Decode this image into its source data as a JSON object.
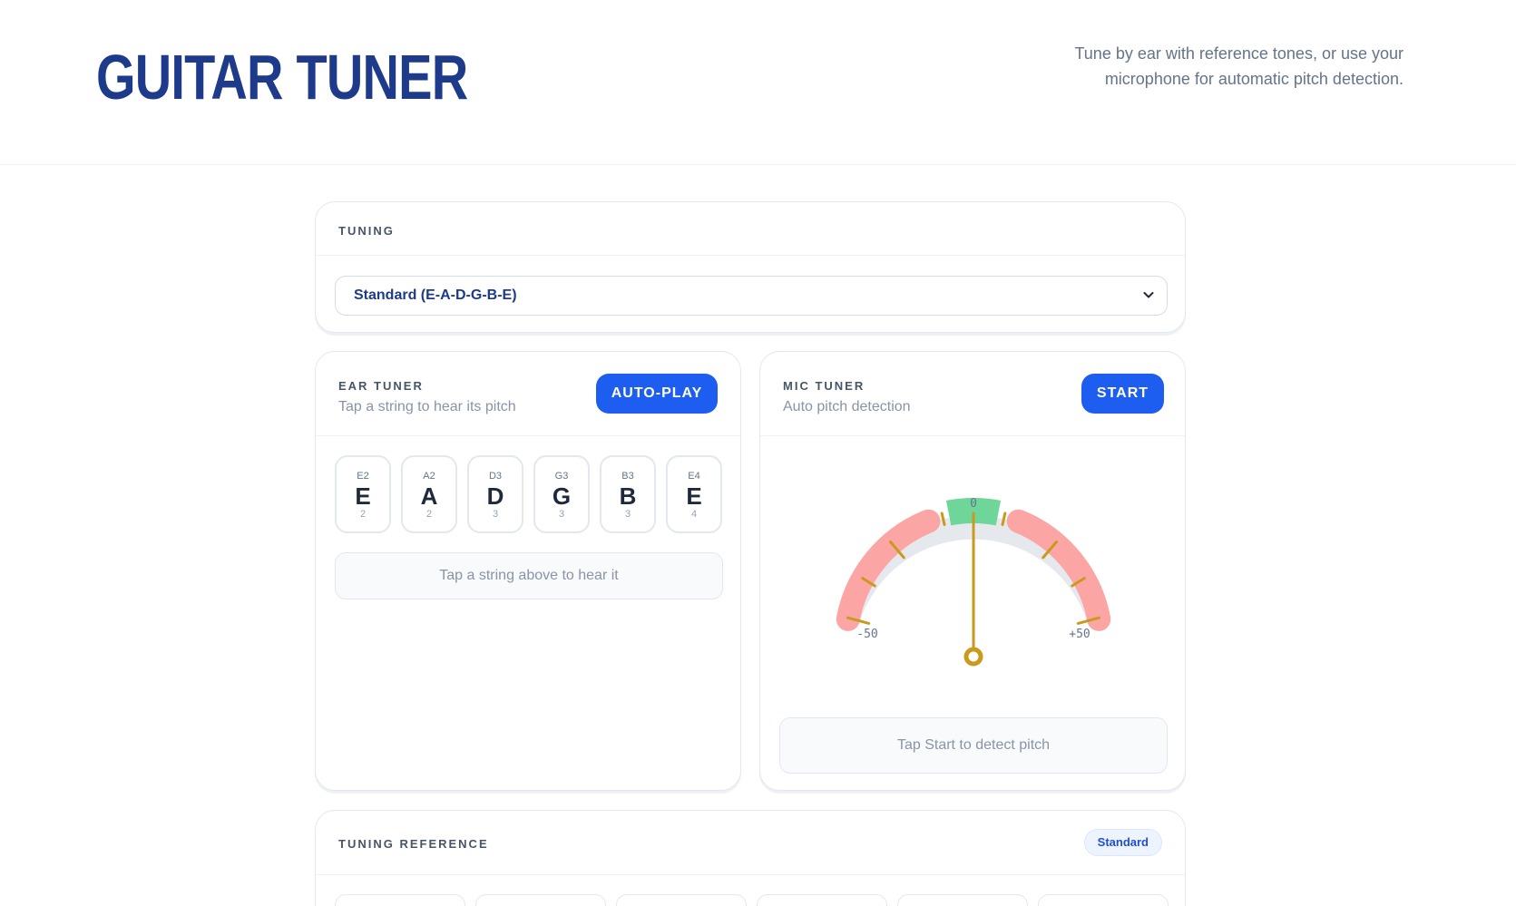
{
  "header": {
    "title": "GUITAR TUNER",
    "tagline": "Tune by ear with reference tones, or use your microphone for automatic pitch detection."
  },
  "tuning": {
    "label": "TUNING",
    "selected": "Standard (E-A-D-G-B-E)"
  },
  "ear_tuner": {
    "label": "EAR TUNER",
    "subtitle": "Tap a string to hear its pitch",
    "autoplay_label": "AUTO-PLAY",
    "strings": [
      {
        "name": "E2",
        "letter": "E",
        "octave": "2"
      },
      {
        "name": "A2",
        "letter": "A",
        "octave": "2"
      },
      {
        "name": "D3",
        "letter": "D",
        "octave": "3"
      },
      {
        "name": "G3",
        "letter": "G",
        "octave": "3"
      },
      {
        "name": "B3",
        "letter": "B",
        "octave": "3"
      },
      {
        "name": "E4",
        "letter": "E",
        "octave": "4"
      }
    ],
    "hint": "Tap a string above to hear it"
  },
  "mic_tuner": {
    "label": "MIC TUNER",
    "subtitle": "Auto pitch detection",
    "start_label": "START",
    "gauge": {
      "min_label": "-50",
      "center_label": "0",
      "max_label": "+50",
      "needle_cents": 0
    },
    "hint": "Tap Start to detect pitch"
  },
  "reference": {
    "label": "TUNING REFERENCE",
    "badge": "Standard"
  },
  "colors": {
    "title": "#1e3a8a",
    "accent": "#1d5ef0",
    "in_tune_zone": "#6fd69a",
    "off_zone": "#fca5a5",
    "needle": "#ca9a1c"
  }
}
